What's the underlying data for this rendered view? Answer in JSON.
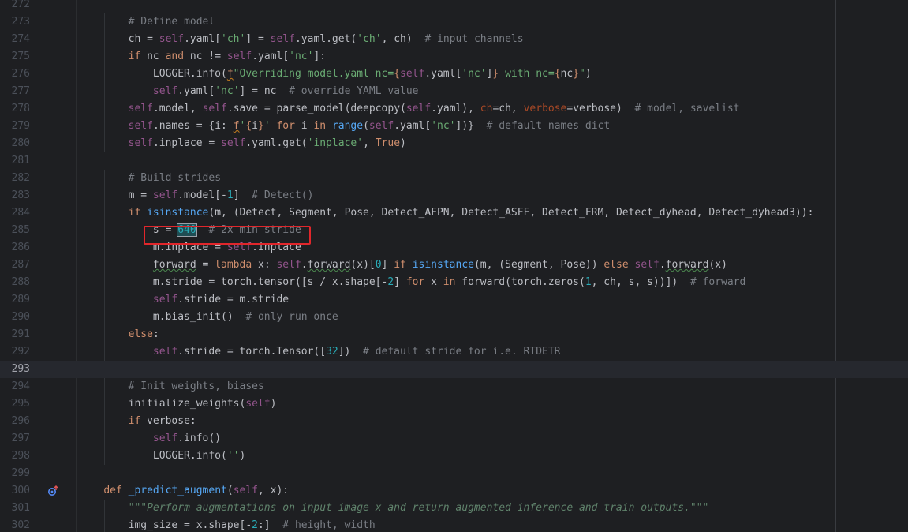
{
  "editor": {
    "current_line": 293,
    "highlight_color": "#e1262b",
    "gutter_icon": "override-method-icon",
    "lines": [
      {
        "n": "272",
        "text": ""
      },
      {
        "n": "273",
        "text": "        # Define model"
      },
      {
        "n": "274",
        "text": "        ch = self.yaml['ch'] = self.yaml.get('ch', ch)  # input channels"
      },
      {
        "n": "275",
        "text": "        if nc and nc != self.yaml['nc']:"
      },
      {
        "n": "276",
        "text": "            LOGGER.info(f\"Overriding model.yaml nc={self.yaml['nc']} with nc={nc}\")"
      },
      {
        "n": "277",
        "text": "            self.yaml['nc'] = nc  # override YAML value"
      },
      {
        "n": "278",
        "text": "        self.model, self.save = parse_model(deepcopy(self.yaml), ch=ch, verbose=verbose)  # model, savelist"
      },
      {
        "n": "279",
        "text": "        self.names = {i: f'{i}' for i in range(self.yaml['nc'])}  # default names dict"
      },
      {
        "n": "280",
        "text": "        self.inplace = self.yaml.get('inplace', True)"
      },
      {
        "n": "281",
        "text": ""
      },
      {
        "n": "282",
        "text": "        # Build strides"
      },
      {
        "n": "283",
        "text": "        m = self.model[-1]  # Detect()"
      },
      {
        "n": "284",
        "text": "        if isinstance(m, (Detect, Segment, Pose, Detect_AFPN, Detect_ASFF, Detect_FRM, Detect_dyhead, Detect_dyhead3)):"
      },
      {
        "n": "285",
        "text": "            s = 640  # 2x min stride"
      },
      {
        "n": "286",
        "text": "            m.inplace = self.inplace"
      },
      {
        "n": "287",
        "text": "            forward = lambda x: self.forward(x)[0] if isinstance(m, (Segment, Pose)) else self.forward(x)"
      },
      {
        "n": "288",
        "text": "            m.stride = torch.tensor([s / x.shape[-2] for x in forward(torch.zeros(1, ch, s, s))])  # forward"
      },
      {
        "n": "289",
        "text": "            self.stride = m.stride"
      },
      {
        "n": "290",
        "text": "            m.bias_init()  # only run once"
      },
      {
        "n": "291",
        "text": "        else:"
      },
      {
        "n": "292",
        "text": "            self.stride = torch.Tensor([32])  # default stride for i.e. RTDETR"
      },
      {
        "n": "293",
        "text": ""
      },
      {
        "n": "294",
        "text": "        # Init weights, biases"
      },
      {
        "n": "295",
        "text": "        initialize_weights(self)"
      },
      {
        "n": "296",
        "text": "        if verbose:"
      },
      {
        "n": "297",
        "text": "            self.info()"
      },
      {
        "n": "298",
        "text": "            LOGGER.info('')"
      },
      {
        "n": "299",
        "text": ""
      },
      {
        "n": "300",
        "text": "    def _predict_augment(self, x):"
      },
      {
        "n": "301",
        "text": "        \"\"\"Perform augmentations on input image x and return augmented inference and train outputs.\"\"\""
      },
      {
        "n": "302",
        "text": "        img_size = x.shape[-2:]  # height, width"
      }
    ]
  }
}
